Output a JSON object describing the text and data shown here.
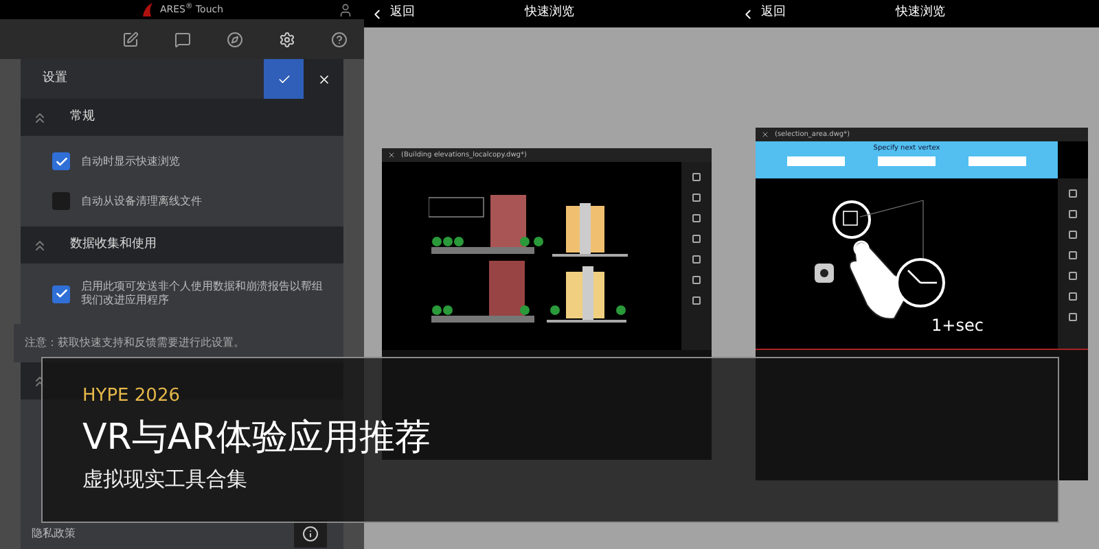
{
  "app_header": {
    "logo_text": "ARES$^{®}$ Touch"
  },
  "settings_dialog": {
    "title": "设置",
    "sections": [
      {
        "kind": "checkboxes",
        "title": "常规",
        "items": [
          {
            "label": "自动时显示快速浏览",
            "checked": true
          },
          {
            "label": "自动从设备清理离线文件",
            "checked": false
          }
        ]
      },
      {
        "kind": "checkboxes",
        "title": "数据收集和使用",
        "items": [
          {
            "label": "启用此项可发送非个人使用数据和崩溃报告以帮组我们改进应用程序",
            "checked": true
          }
        ],
        "note": "注意：获取快速支持和反馈需要进行此设置。"
      },
      {
        "kind": "links",
        "items": [
          {
            "label": "隐私政策"
          }
        ]
      }
    ]
  },
  "quick_views": [
    {
      "kind": "elevations",
      "back": "返回",
      "title": "快速浏览",
      "file_title": "(Building elevations_localcopy.dwg*)"
    },
    {
      "kind": "loupe",
      "back": "返回",
      "title": "快速浏览",
      "file_title": "(selection_area.dwg*)",
      "prompt": "Specify next vertex",
      "hint": "1+sec"
    }
  ],
  "banner": {
    "tag": "HYPE 2026",
    "title": "VR与AR体验应用推荐",
    "subtitle": "虚拟现实工具合集"
  }
}
